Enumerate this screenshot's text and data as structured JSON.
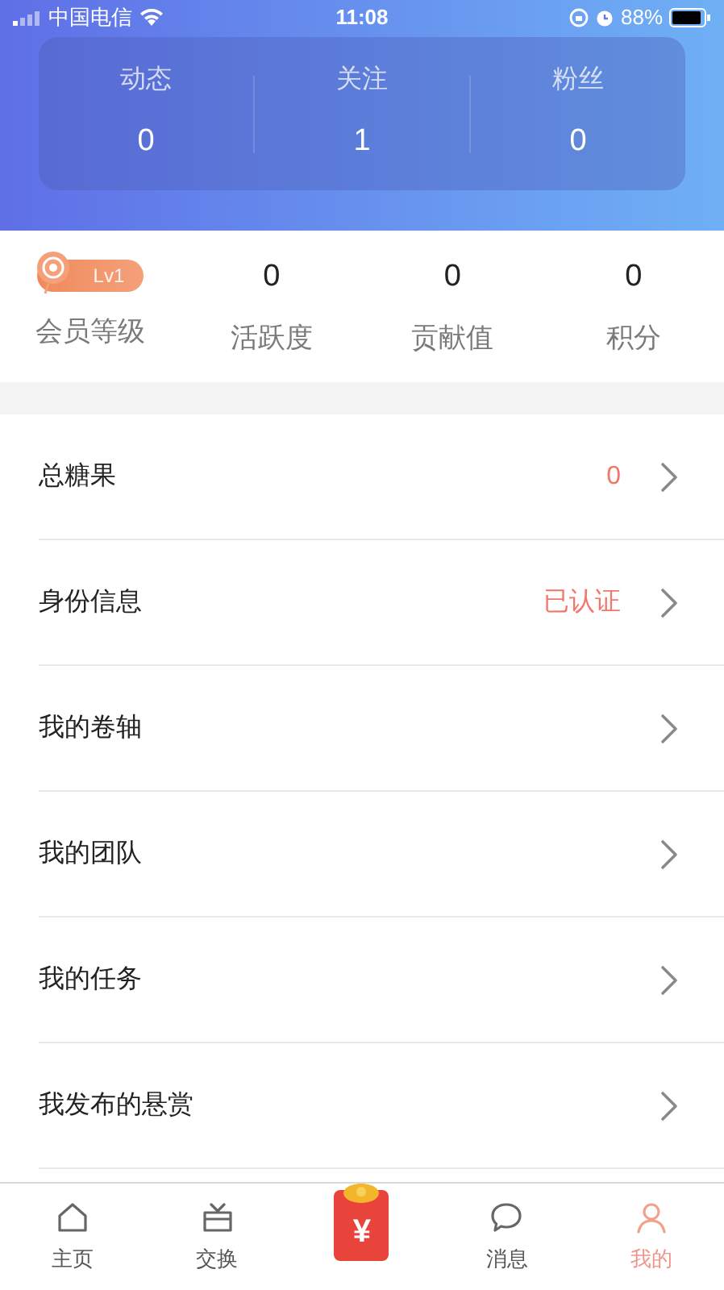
{
  "status_bar": {
    "carrier": "中国电信",
    "time": "11:08",
    "battery": "88%"
  },
  "social_stats": [
    {
      "label": "动态",
      "value": "0"
    },
    {
      "label": "关注",
      "value": "1"
    },
    {
      "label": "粉丝",
      "value": "0"
    }
  ],
  "member": {
    "level_badge": "Lv1",
    "label": "会员等级"
  },
  "metrics": [
    {
      "value": "0",
      "label": "活跃度"
    },
    {
      "value": "0",
      "label": "贡献值"
    },
    {
      "value": "0",
      "label": "积分"
    }
  ],
  "menu": [
    {
      "label": "总糖果",
      "value": "0"
    },
    {
      "label": "身份信息",
      "value": "已认证"
    },
    {
      "label": "我的卷轴"
    },
    {
      "label": "我的团队"
    },
    {
      "label": "我的任务"
    },
    {
      "label": "我发布的悬赏"
    }
  ],
  "tab_bar": [
    {
      "kind": "home",
      "label": "主页",
      "selected": false
    },
    {
      "kind": "exchange",
      "label": "交换",
      "selected": false
    },
    {
      "kind": "envelope",
      "symbol": "¥"
    },
    {
      "kind": "message",
      "label": "消息",
      "selected": false
    },
    {
      "kind": "profile",
      "label": "我的",
      "selected": true
    }
  ]
}
